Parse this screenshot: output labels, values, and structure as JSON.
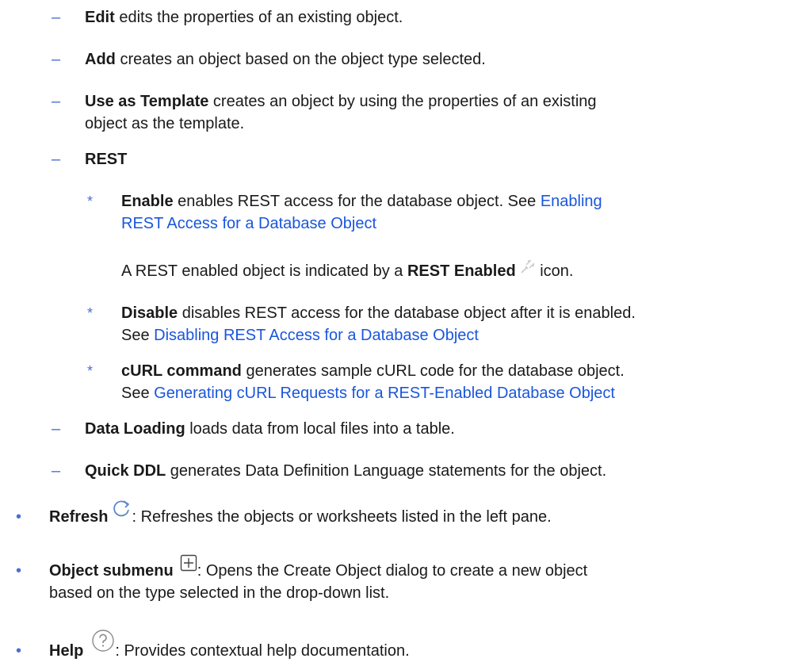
{
  "items": {
    "edit": {
      "term": "Edit",
      "desc": " edits the properties of an existing object."
    },
    "add": {
      "term": "Add",
      "desc": " creates an object based on the object type selected."
    },
    "template": {
      "term": "Use as Template",
      "desc_1": " creates an object by using the properties of an existing",
      "desc_2": "object as the template."
    },
    "rest": {
      "term": "REST"
    },
    "enable": {
      "term": "Enable",
      "desc": " enables REST access for the database object. See ",
      "link_1": "Enabling",
      "link_2": "REST Access for a Database Object"
    },
    "enabled_note": {
      "prefix": "A REST enabled object is indicated by a ",
      "term": "REST Enabled",
      "suffix": " icon."
    },
    "disable": {
      "term": "Disable",
      "desc": " disables REST access for the database object after it is enabled.",
      "see": "See ",
      "link": "Disabling REST Access for a Database Object"
    },
    "curl": {
      "term": "cURL command",
      "desc": " generates sample cURL code for the database object.",
      "see": "See ",
      "link": "Generating cURL Requests for a REST-Enabled Database Object"
    },
    "data_loading": {
      "term": "Data Loading",
      "desc": " loads data from local files into a table."
    },
    "quick_ddl": {
      "term": "Quick DDL",
      "desc": " generates Data Definition Language statements for the object."
    },
    "refresh": {
      "term": "Refresh",
      "desc": ": Refreshes the objects or worksheets listed in the left pane."
    },
    "object_submenu": {
      "term": "Object submenu",
      "desc_1": ": Opens the Create Object dialog to create a new object",
      "desc_2": "based on the type selected in the drop-down list."
    },
    "help": {
      "term": "Help",
      "desc": ": Provides contextual help documentation."
    }
  },
  "markers": {
    "dash": "–",
    "star": "*",
    "bullet": "•"
  },
  "icons": {
    "rest_enabled": "plug-icon",
    "refresh": "refresh-icon",
    "object_submenu": "plus-box-icon",
    "help": "help-circle-icon"
  },
  "colors": {
    "marker": "#4a6fd1",
    "link": "#1a56db",
    "text": "#1a1a1a"
  }
}
